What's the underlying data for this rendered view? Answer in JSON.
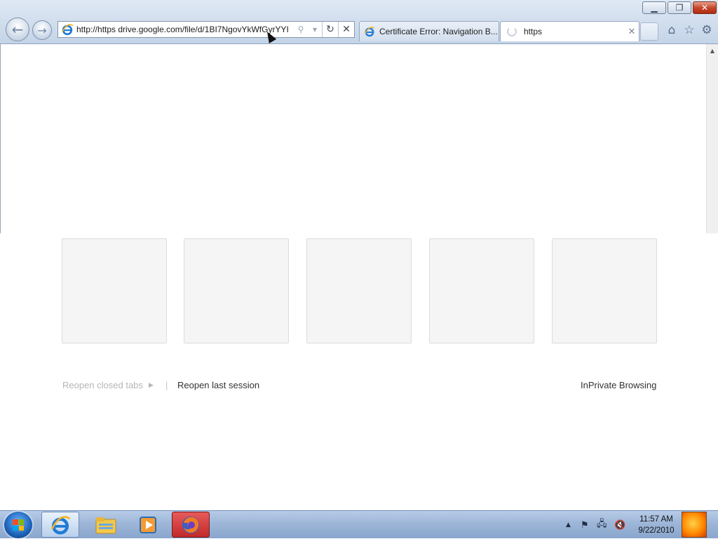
{
  "window": {
    "minimize_icon": "minimize-icon",
    "maximize_icon": "restore-icon",
    "close_icon": "close-icon"
  },
  "toolbar": {
    "back_glyph": "←",
    "forward_glyph": "→",
    "address_value": "http://https drive.google.com/file/d/1BI7NgovYkWfGyrYYI",
    "search_glyph": "⚲",
    "dropdown_glyph": "▾",
    "refresh_glyph": "↻",
    "stop_glyph": "✕"
  },
  "tabs": [
    {
      "label": "Certificate Error: Navigation B...",
      "icon": "ie-icon",
      "state": "inactive"
    },
    {
      "label": "https",
      "icon": "loading-spinner-icon",
      "state": "active",
      "close_glyph": "✕"
    }
  ],
  "command_icons": {
    "home": "⌂",
    "favorites": "☆",
    "tools": "⚙"
  },
  "new_tab_page": {
    "tiles": 5,
    "reopen_closed_tabs": "Reopen closed tabs",
    "reopen_arrow": "▶",
    "separator": "|",
    "reopen_last_session": "Reopen last session",
    "inprivate_browsing": "InPrivate Browsing"
  },
  "taskbar": {
    "apps": [
      "internet-explorer",
      "windows-explorer",
      "windows-media-player",
      "firefox"
    ],
    "tray": {
      "up_arrow": "▲",
      "flag": "⚑",
      "network": "🖧",
      "volume": "🔇"
    },
    "clock_time": "11:57 AM",
    "clock_date": "9/22/2010"
  },
  "colors": {
    "chrome_bg": "#cfdcec",
    "taskbar_bg": "#9db6d8",
    "tile_bg": "#f5f5f5",
    "muted_link": "#b5b5b5",
    "link": "#333333"
  }
}
